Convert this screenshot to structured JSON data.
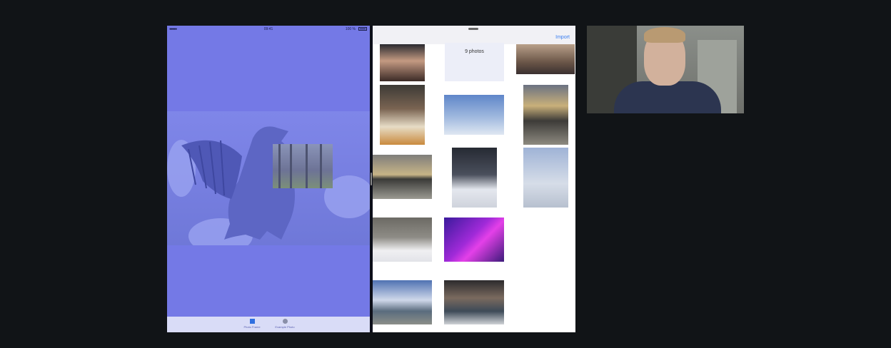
{
  "left_app": {
    "status": {
      "signal": "●●●●● ",
      "time": "09:41",
      "battery": "100 %"
    },
    "tabs": [
      {
        "label": "Photo Frame",
        "icon": "square-icon"
      },
      {
        "label": "Example Photo",
        "icon": "circle-icon"
      }
    ]
  },
  "right_app": {
    "import_label": "Import",
    "album_count": "9 photos"
  },
  "colors": {
    "tint": "#7479e6",
    "accent": "#3a7ef0",
    "background": "#111417"
  }
}
